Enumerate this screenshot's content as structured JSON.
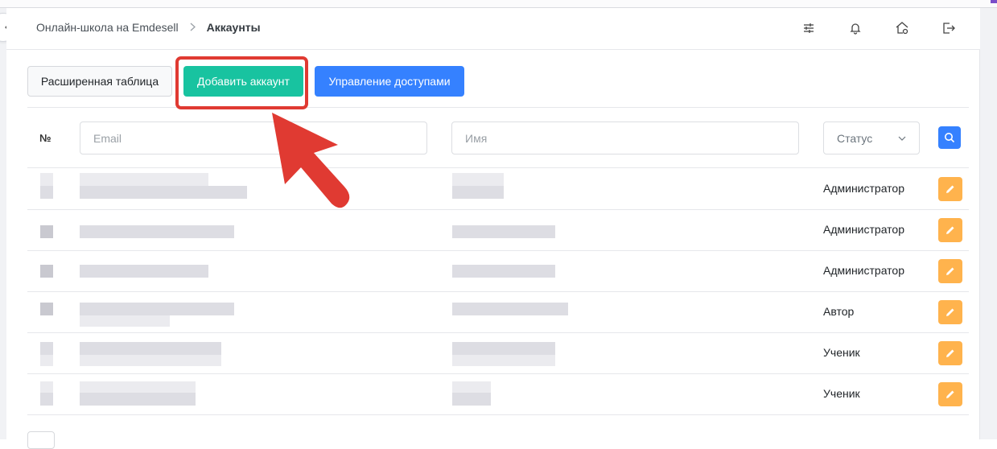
{
  "breadcrumb": {
    "root": "Онлайн-школа на Emdesell",
    "current": "Аккаунты"
  },
  "header_icons": [
    "sliders-icon",
    "bell-icon",
    "home-settings-icon",
    "logout-icon"
  ],
  "toolbar": {
    "extended_table_label": "Расширенная таблица",
    "add_account_label": "Добавить аккаунт",
    "manage_access_label": "Управление доступами"
  },
  "filters": {
    "num_label": "№",
    "email_placeholder": "Email",
    "name_placeholder": "Имя",
    "status_label": "Статус"
  },
  "rows": [
    {
      "role": "Администратор"
    },
    {
      "role": "Администратор"
    },
    {
      "role": "Администратор"
    },
    {
      "role": "Автор"
    },
    {
      "role": "Ученик"
    },
    {
      "role": "Ученик"
    }
  ],
  "colors": {
    "add_button": "#18c3a0",
    "access_button": "#3581ff",
    "edit_button": "#ffb34d",
    "annotation": "#e03a32"
  }
}
